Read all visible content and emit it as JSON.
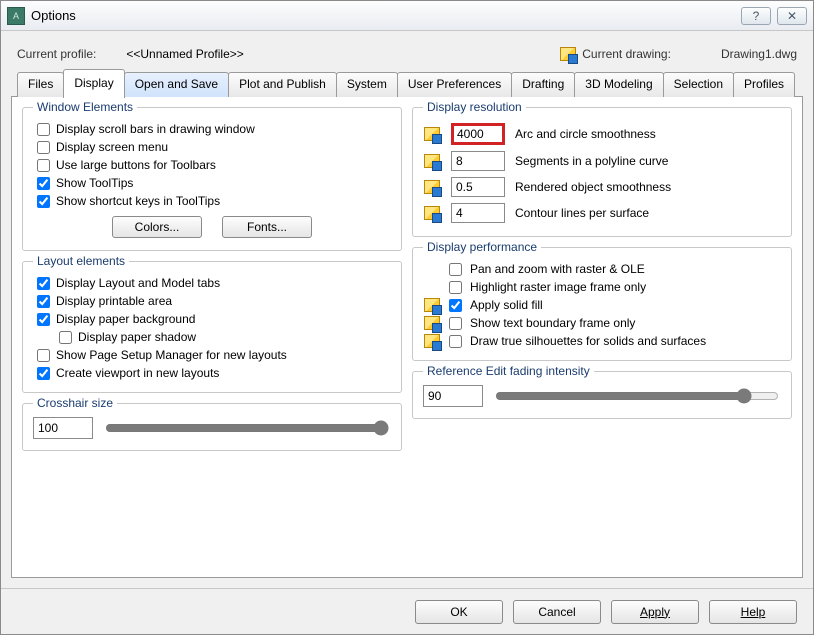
{
  "window": {
    "title": "Options"
  },
  "profile": {
    "currentProfileLabel": "Current profile:",
    "currentProfileValue": "<<Unnamed Profile>>",
    "currentDrawingLabel": "Current drawing:",
    "currentDrawingValue": "Drawing1.dwg"
  },
  "tabs": [
    "Files",
    "Display",
    "Open and Save",
    "Plot and Publish",
    "System",
    "User Preferences",
    "Drafting",
    "3D Modeling",
    "Selection",
    "Profiles"
  ],
  "activeTab": "Display",
  "groups": {
    "windowElements": {
      "legend": "Window Elements",
      "items": [
        {
          "label": "Display scroll bars in drawing window",
          "checked": false
        },
        {
          "label": "Display screen menu",
          "checked": false
        },
        {
          "label": "Use large buttons for Toolbars",
          "checked": false
        },
        {
          "label": "Show ToolTips",
          "checked": true
        },
        {
          "label": "Show shortcut keys in ToolTips",
          "checked": true
        }
      ],
      "buttons": {
        "colors": "Colors...",
        "fonts": "Fonts..."
      }
    },
    "layoutElements": {
      "legend": "Layout elements",
      "items": [
        {
          "label": "Display Layout and Model tabs",
          "checked": true
        },
        {
          "label": "Display printable area",
          "checked": true
        },
        {
          "label": "Display paper background",
          "checked": true
        },
        {
          "label": "Display paper shadow",
          "checked": false,
          "indent": true
        },
        {
          "label": "Show Page Setup Manager for new layouts",
          "checked": false
        },
        {
          "label": "Create viewport in new layouts",
          "checked": true
        }
      ]
    },
    "crosshair": {
      "legend": "Crosshair size",
      "value": "100"
    },
    "displayResolution": {
      "legend": "Display resolution",
      "rows": [
        {
          "value": "4000",
          "label": "Arc and circle smoothness",
          "highlight": true
        },
        {
          "value": "8",
          "label": "Segments in a polyline curve"
        },
        {
          "value": "0.5",
          "label": "Rendered object smoothness"
        },
        {
          "value": "4",
          "label": "Contour lines per surface"
        }
      ]
    },
    "displayPerformance": {
      "legend": "Display performance",
      "items": [
        {
          "label": "Pan and zoom with raster & OLE",
          "checked": false,
          "icon": false
        },
        {
          "label": "Highlight raster image frame only",
          "checked": false,
          "icon": false
        },
        {
          "label": "Apply solid fill",
          "checked": true,
          "icon": true
        },
        {
          "label": "Show text boundary frame only",
          "checked": false,
          "icon": true
        },
        {
          "label": "Draw true silhouettes for solids and surfaces",
          "checked": false,
          "icon": true
        }
      ]
    },
    "refEdit": {
      "legend": "Reference Edit fading intensity",
      "value": "90"
    }
  },
  "footer": {
    "ok": "OK",
    "cancel": "Cancel",
    "apply": "Apply",
    "help": "Help"
  }
}
